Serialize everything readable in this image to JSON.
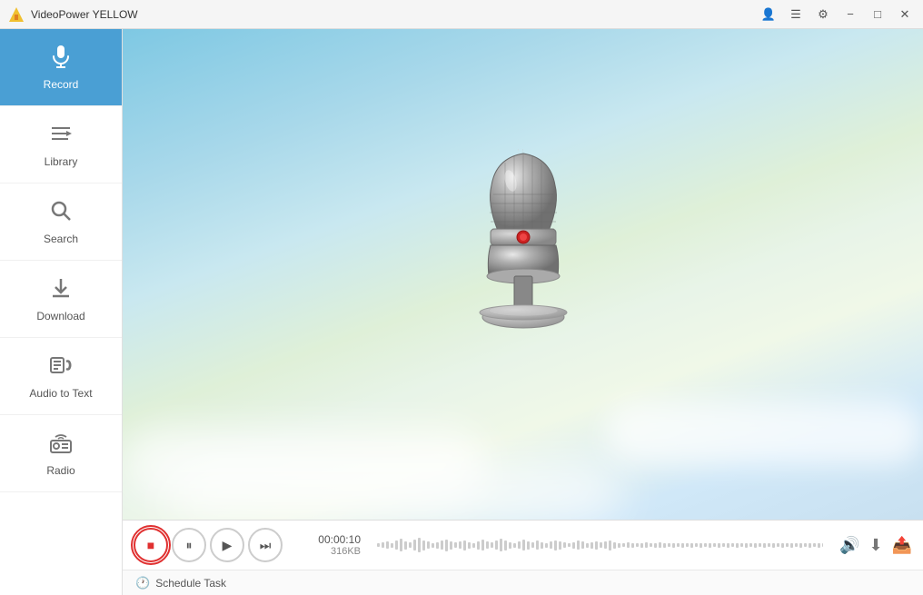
{
  "app": {
    "title": "VideoPower YELLOW",
    "logo": "VP"
  },
  "titlebar": {
    "account_icon": "👤",
    "menu_icon": "☰",
    "settings_icon": "⚙",
    "minimize_label": "−",
    "maximize_label": "□",
    "close_label": "✕"
  },
  "sidebar": {
    "items": [
      {
        "id": "record",
        "label": "Record",
        "icon": "mic",
        "active": true
      },
      {
        "id": "library",
        "label": "Library",
        "icon": "library",
        "active": false
      },
      {
        "id": "search",
        "label": "Search",
        "icon": "search",
        "active": false
      },
      {
        "id": "download",
        "label": "Download",
        "icon": "download",
        "active": false
      },
      {
        "id": "audio-to-text",
        "label": "Audio to Text",
        "icon": "audio-text",
        "active": false
      },
      {
        "id": "radio",
        "label": "Radio",
        "icon": "radio",
        "active": false
      }
    ]
  },
  "player": {
    "time": "00:00:10",
    "size": "316KB",
    "stop_btn": "■",
    "pause_btn": "⏸",
    "play_btn": "▶",
    "next_btn": "⏭",
    "volume_icon": "🔊",
    "download_icon": "⬇",
    "share_icon": "📤"
  },
  "schedule": {
    "label": "Schedule Task"
  },
  "colors": {
    "active_sidebar": "#4a9fd4",
    "record_btn_border": "#e03030"
  }
}
